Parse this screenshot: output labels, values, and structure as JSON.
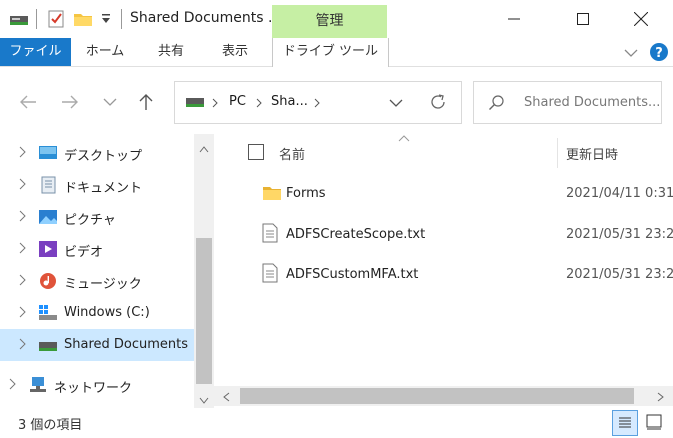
{
  "window": {
    "title": "Shared Documents ...",
    "context_tab": "管理"
  },
  "ribbon": {
    "tabs": [
      "ファイル",
      "ホーム",
      "共有",
      "表示",
      "ドライブ ツール"
    ]
  },
  "address": {
    "crumbs": [
      "PC",
      "Sha..."
    ]
  },
  "search": {
    "placeholder": "Shared Documents..."
  },
  "sidebar": {
    "items": [
      {
        "label": "デスクトップ",
        "icon": "desktop-icon"
      },
      {
        "label": "ドキュメント",
        "icon": "documents-icon"
      },
      {
        "label": "ピクチャ",
        "icon": "pictures-icon"
      },
      {
        "label": "ビデオ",
        "icon": "videos-icon"
      },
      {
        "label": "ミュージック",
        "icon": "music-icon"
      },
      {
        "label": "Windows (C:)",
        "icon": "drive-c-icon"
      },
      {
        "label": "Shared Documents",
        "icon": "network-drive-icon"
      },
      {
        "label": "ネットワーク",
        "icon": "network-icon"
      }
    ]
  },
  "columns": {
    "name": "名前",
    "date": "更新日時"
  },
  "files": [
    {
      "name": "Forms",
      "date": "2021/04/11 0:31",
      "icon": "folder-icon"
    },
    {
      "name": "ADFSCreateScope.txt",
      "date": "2021/05/31 23:2",
      "icon": "text-file-icon"
    },
    {
      "name": "ADFSCustomMFA.txt",
      "date": "2021/05/31 23:2",
      "icon": "text-file-icon"
    }
  ],
  "status": {
    "count": "3 個の項目"
  },
  "colors": {
    "file_tab": "#1979ca",
    "context_tab": "#c6efa4",
    "selected": "#cce8ff"
  }
}
